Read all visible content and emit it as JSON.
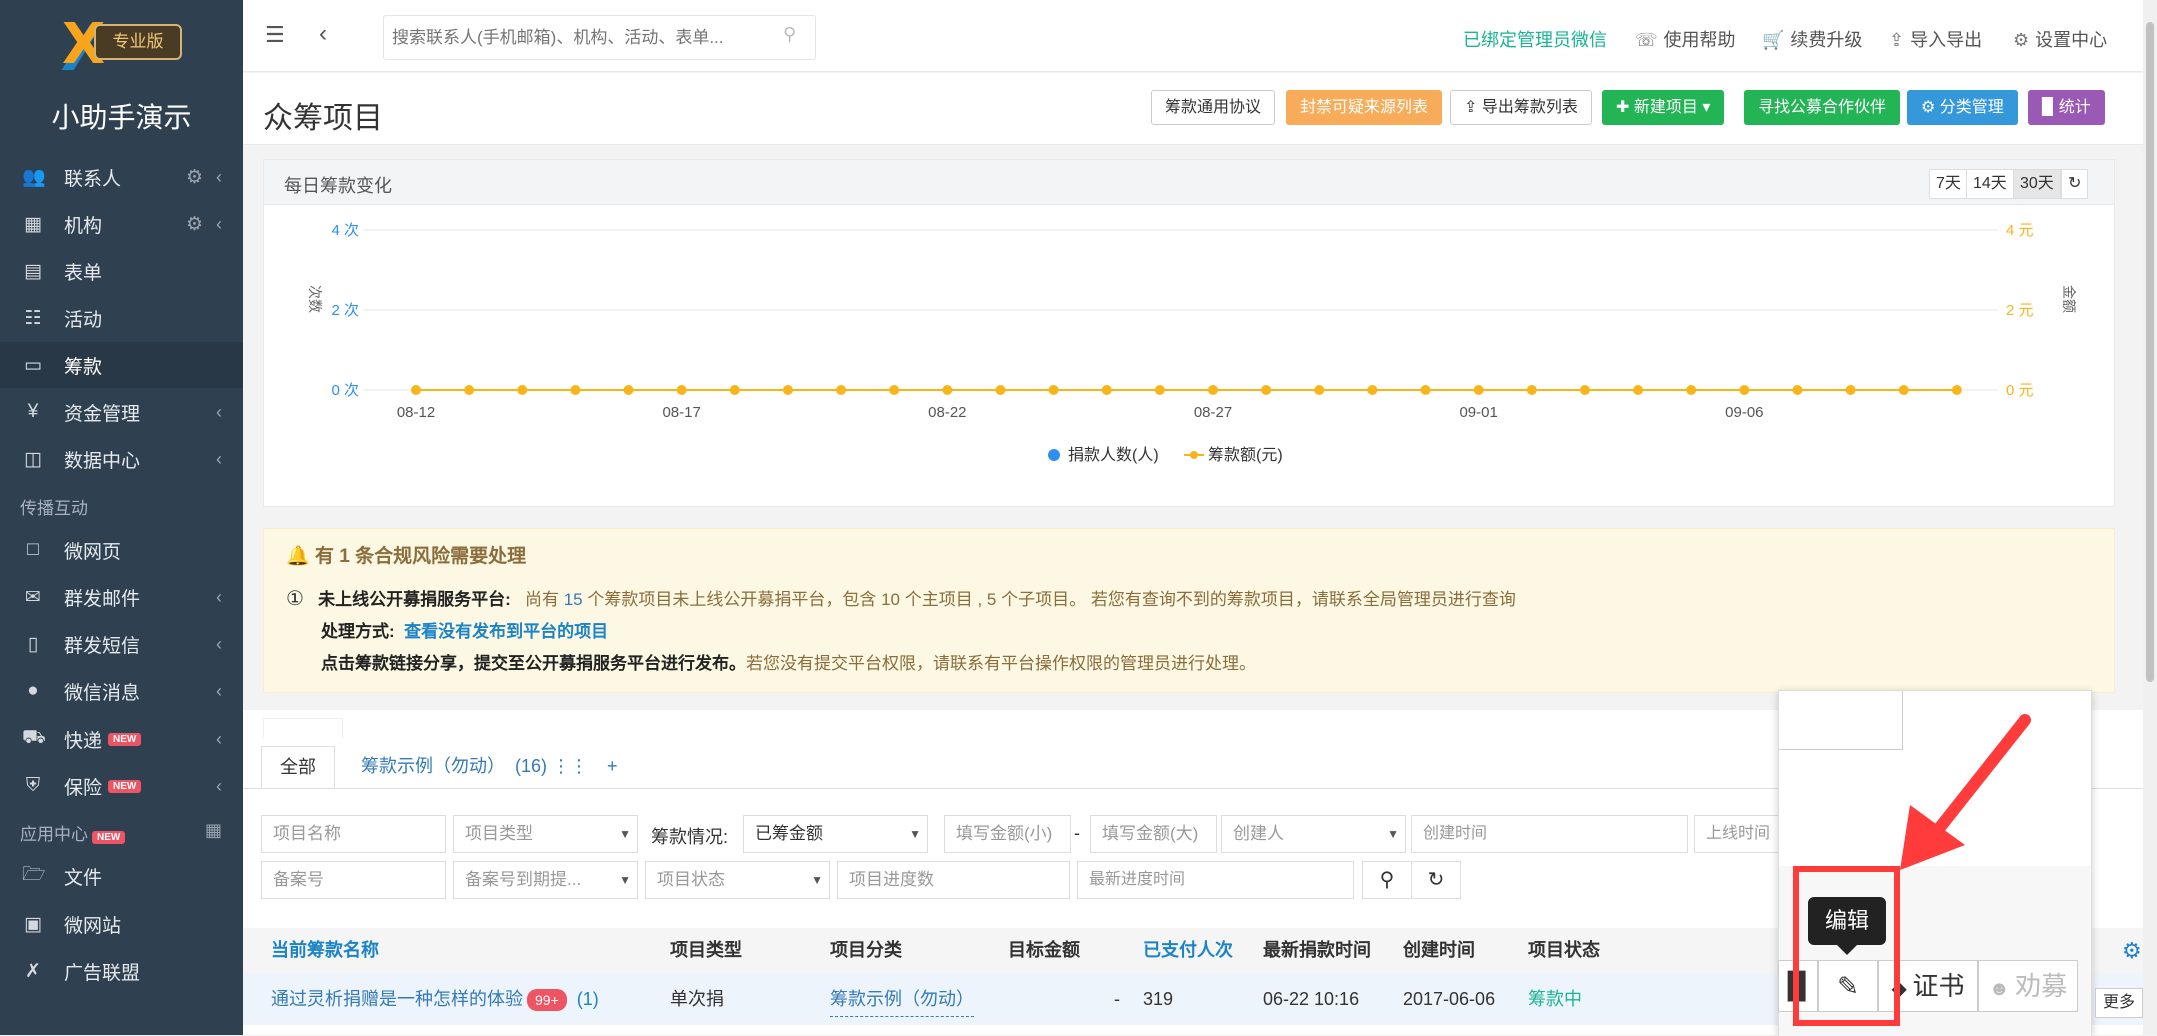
{
  "sidebar": {
    "logo_badge": "专业版",
    "app_name": "小助手演示",
    "items": [
      {
        "label": "联系人",
        "icon": "contacts-icon"
      },
      {
        "label": "机构",
        "icon": "building-icon"
      },
      {
        "label": "表单",
        "icon": "form-icon"
      },
      {
        "label": "活动",
        "icon": "calendar-icon"
      },
      {
        "label": "筹款",
        "icon": "money-icon"
      },
      {
        "label": "资金管理",
        "icon": "yen-icon"
      },
      {
        "label": "数据中心",
        "icon": "database-icon"
      },
      {
        "label": "微网页",
        "icon": "page-icon"
      },
      {
        "label": "群发邮件",
        "icon": "mail-icon"
      },
      {
        "label": "群发短信",
        "icon": "phone-icon"
      },
      {
        "label": "微信消息",
        "icon": "wechat-icon"
      },
      {
        "label": "快递",
        "icon": "truck-icon",
        "badge": "NEW"
      },
      {
        "label": "保险",
        "icon": "shield-icon",
        "badge": "NEW"
      },
      {
        "label": "文件",
        "icon": "folder-icon"
      },
      {
        "label": "微网站",
        "icon": "site-icon"
      },
      {
        "label": "广告联盟",
        "icon": "ad-icon"
      }
    ],
    "section_spread": "传播互动",
    "section_apps": "应用中心",
    "section_apps_badge": "NEW"
  },
  "topbar": {
    "search_placeholder": "搜索联系人(手机邮箱)、机构、活动、表单...",
    "wechat_bound": "已绑定管理员微信",
    "help": "使用帮助",
    "upgrade": "续费升级",
    "import_export": "导入导出",
    "settings": "设置中心"
  },
  "header": {
    "title": "众筹项目",
    "btn_agreement": "筹款通用协议",
    "btn_block": "封禁可疑来源列表",
    "btn_export": "导出筹款列表",
    "btn_new": "新建项目",
    "btn_partner": "寻找公募合作伙伴",
    "btn_category": "分类管理",
    "btn_stats": "统计"
  },
  "chart_panel": {
    "title": "每日筹款变化",
    "ranges": [
      "7天",
      "14天",
      "30天"
    ],
    "active_range": "30天"
  },
  "chart_data": {
    "type": "line",
    "x": [
      "08-12",
      "08-13",
      "08-14",
      "08-15",
      "08-16",
      "08-17",
      "08-18",
      "08-19",
      "08-20",
      "08-21",
      "08-22",
      "08-23",
      "08-24",
      "08-25",
      "08-26",
      "08-27",
      "08-28",
      "08-29",
      "08-30",
      "08-31",
      "09-01",
      "09-02",
      "09-03",
      "09-04",
      "09-05",
      "09-06",
      "09-07",
      "09-08",
      "09-09",
      "09-10"
    ],
    "xticks": [
      "08-12",
      "08-17",
      "08-22",
      "08-27",
      "09-01",
      "09-06"
    ],
    "series": [
      {
        "name": "捐款人数(人)",
        "axis": "left",
        "color": "#2f8ff0",
        "values": [
          0,
          0,
          0,
          0,
          0,
          0,
          0,
          0,
          0,
          0,
          0,
          0,
          0,
          0,
          0,
          0,
          0,
          0,
          0,
          0,
          0,
          0,
          0,
          0,
          0,
          0,
          0,
          0,
          0,
          0
        ]
      },
      {
        "name": "筹款额(元)",
        "axis": "right",
        "color": "#f8b51b",
        "values": [
          0,
          0,
          0,
          0,
          0,
          0,
          0,
          0,
          0,
          0,
          0,
          0,
          0,
          0,
          0,
          0,
          0,
          0,
          0,
          0,
          0,
          0,
          0,
          0,
          0,
          0,
          0,
          0,
          0,
          0
        ]
      }
    ],
    "left_ticks": [
      "0 次",
      "2 次",
      "4 次"
    ],
    "right_ticks": [
      "0 元",
      "2 元",
      "4 元"
    ],
    "ylabel_left": "次数",
    "ylabel_right": "金额",
    "ylim": [
      0,
      4
    ],
    "grid": true,
    "legend": "bottom"
  },
  "alert": {
    "title": "有 1 条合规风险需要处理",
    "num": "①",
    "line1_bold": "未上线公开募捐服务平台:",
    "line1_a": "尚有",
    "line1_count": "15",
    "line1_b": "个筹款项目未上线公开募捐平台，包含",
    "line1_main": "10",
    "line1_c": "个主项目 ,",
    "line1_sub": "5",
    "line1_d": "个子项目。 若您有查询不到的筹款项目，请联系全局管理员进行查询",
    "line2_bold": "处理方式:",
    "line2_link": "查看没有发布到平台的项目",
    "line3_bold": "点击筹款链接分享，提交至公开募捐服务平台进行发布。",
    "line3_rest": "若您没有提交平台权限，请联系有平台操作权限的管理员进行处理。"
  },
  "tabs": {
    "all": "全部",
    "example": "筹款示例（勿动）",
    "example_count": "(16)",
    "add": "+"
  },
  "filters": {
    "name": "项目名称",
    "type": "项目类型",
    "status_label": "筹款情况:",
    "amount_sel": "已筹金额",
    "min": "填写金额(小)",
    "dash": "-",
    "max": "填写金额(大)",
    "creator": "创建人",
    "created": "创建时间",
    "online": "上线时间",
    "record": "备案号",
    "record_expire": "备案号到期提...",
    "proj_status": "项目状态",
    "progress": "项目进度数",
    "latest_progress": "最新进度时间"
  },
  "table": {
    "headers": [
      "当前筹款名称",
      "项目类型",
      "项目分类",
      "目标金额",
      "已支付人次",
      "最新捐款时间",
      "创建时间",
      "项目状态"
    ],
    "rows": [
      {
        "name": "通过灵析捐赠是一种怎样的体验",
        "badge": "99+",
        "count": "(1)",
        "type": "单次捐",
        "category": "筹款示例（勿动）",
        "target": "-",
        "paid": "319",
        "latest": "06-22 10:16",
        "created": "2017-06-06",
        "status": "筹款中"
      }
    ]
  },
  "actions": {
    "tooltip": "编辑",
    "cert": "证书",
    "recruit": "劝募",
    "more": "更多"
  }
}
